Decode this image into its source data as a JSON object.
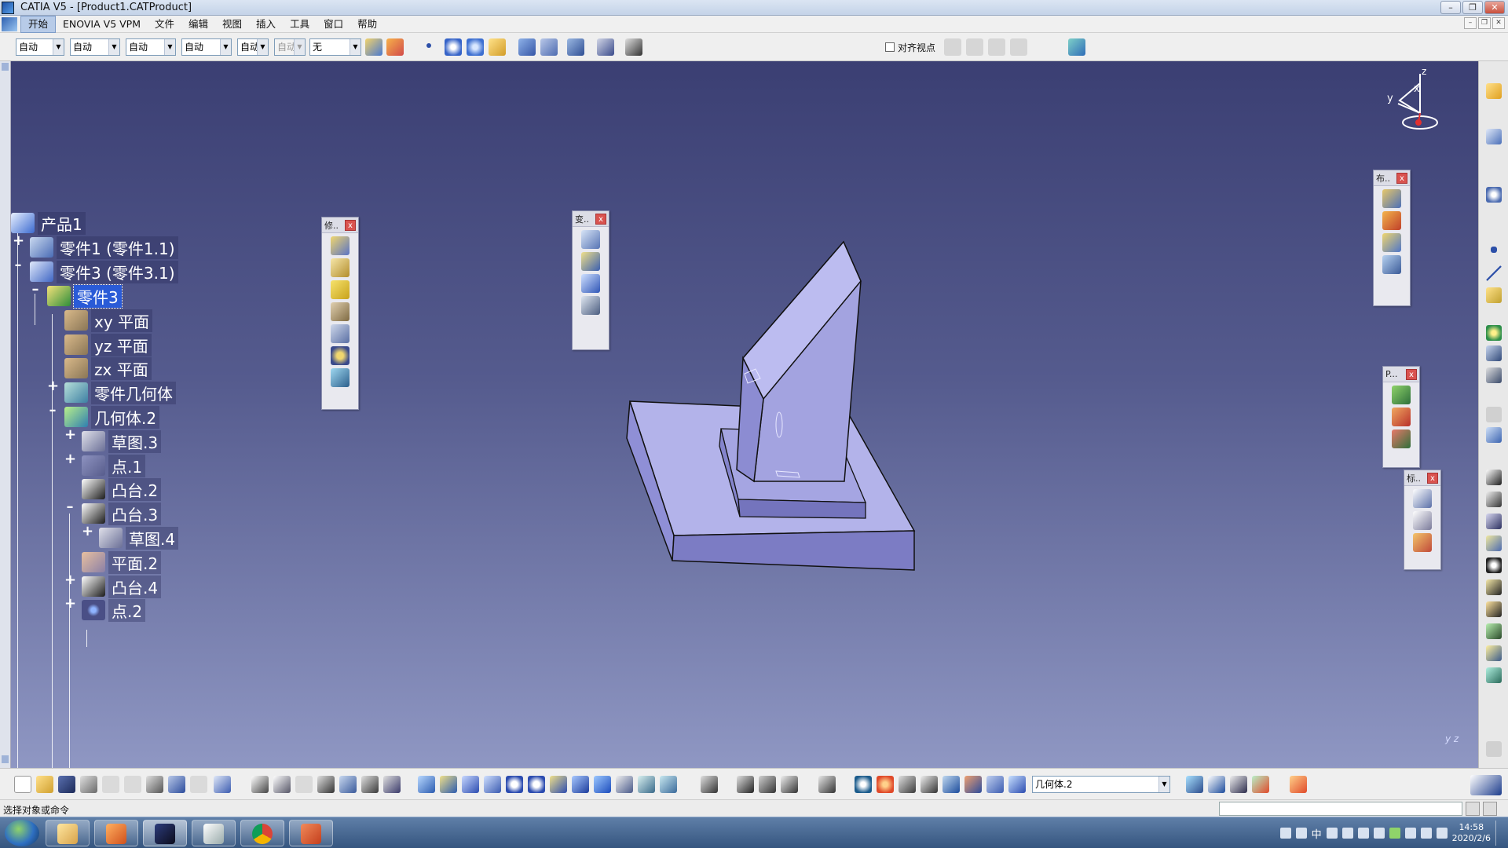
{
  "window": {
    "title": "CATIA V5 - [Product1.CATProduct]",
    "controls": {
      "minimize": "–",
      "restore": "❐",
      "close": "✕"
    },
    "mdi_controls": {
      "minimize": "–",
      "restore": "❐",
      "close": "✕"
    }
  },
  "menu": [
    "开始",
    "ENOVIA V5 VPM",
    "文件",
    "编辑",
    "视图",
    "插入",
    "工具",
    "窗口",
    "帮助"
  ],
  "toolbar": {
    "combos": [
      "自动",
      "自动",
      "自动",
      "自动",
      "自动",
      "自动",
      "无"
    ],
    "align_view_label": "对齐视点"
  },
  "tree": {
    "nodes": [
      {
        "label": "产品1",
        "level": 0,
        "expander": ""
      },
      {
        "label": "零件1 (零件1.1)",
        "level": 1,
        "expander": "+"
      },
      {
        "label": "零件3 (零件3.1)",
        "level": 1,
        "expander": "–"
      },
      {
        "label": "零件3",
        "level": 2,
        "expander": "–",
        "selected": true
      },
      {
        "label": "xy 平面",
        "level": 3,
        "expander": ""
      },
      {
        "label": "yz 平面",
        "level": 3,
        "expander": ""
      },
      {
        "label": "zx 平面",
        "level": 3,
        "expander": ""
      },
      {
        "label": "零件几何体",
        "level": 3,
        "expander": "+"
      },
      {
        "label": "几何体.2",
        "level": 3,
        "expander": "–"
      },
      {
        "label": "草图.3",
        "level": 4,
        "expander": "+"
      },
      {
        "label": "点.1",
        "level": 4,
        "expander": "+"
      },
      {
        "label": "凸台.2",
        "level": 4,
        "expander": ""
      },
      {
        "label": "凸台.3",
        "level": 4,
        "expander": "–"
      },
      {
        "label": "草图.4",
        "level": 5,
        "expander": "+"
      },
      {
        "label": "平面.2",
        "level": 4,
        "expander": ""
      },
      {
        "label": "凸台.4",
        "level": 4,
        "expander": "+"
      },
      {
        "label": "点.2",
        "level": 4,
        "expander": "+"
      }
    ]
  },
  "floating_toolbars": {
    "modify": {
      "title": "修..",
      "close": "x"
    },
    "transform": {
      "title": "变..",
      "close": "x"
    },
    "layout": {
      "title": "布..",
      "close": "x"
    },
    "product": {
      "title": "P...",
      "close": "x"
    },
    "annotation": {
      "title": "标..",
      "close": "x"
    }
  },
  "compass": {
    "x_label": "x",
    "y_label": "y",
    "z_label": "z"
  },
  "viewport_axis_label": "y z",
  "bottom": {
    "body_combo": "几何体.2"
  },
  "status": {
    "text": "选择对象或命令"
  },
  "taskbar": {
    "ime": "中",
    "time": "14:58",
    "date": "2020/2/6"
  },
  "colors": {
    "viewport_top": "#3b3f73",
    "viewport_bottom": "#8f97c3",
    "part_face": "#a9a9e6",
    "selection": "#2a5bd7"
  }
}
